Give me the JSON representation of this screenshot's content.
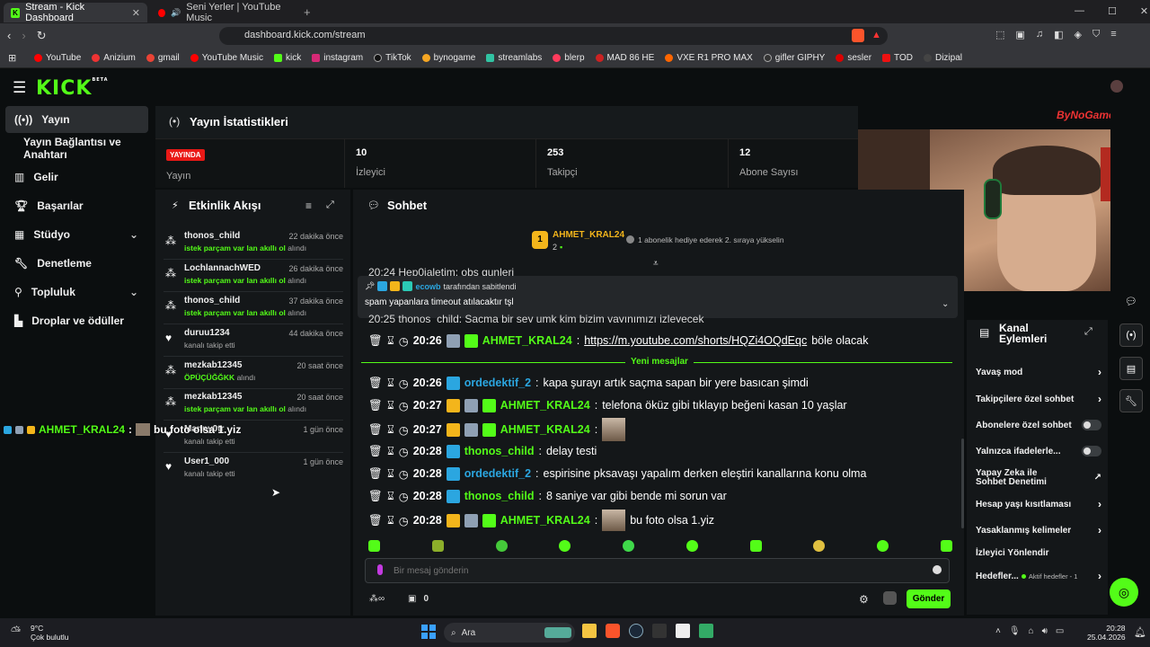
{
  "browser": {
    "tabs": [
      {
        "label": "Stream - Kick Dashboard",
        "active": true
      },
      {
        "label": "Seni Yerler | YouTube Music",
        "active": false
      }
    ],
    "url": "dashboard.kick.com/stream",
    "bookmarks": [
      "YouTube",
      "Anizium",
      "gmail",
      "YouTube Music",
      "kick",
      "instagram",
      "TikTok",
      "bynogame",
      "streamlabs",
      "blerp",
      "MAD 86 HE",
      "VXE R1 PRO MAX",
      "gifler GIPHY",
      "sesler",
      "TOD",
      "Dizipal"
    ]
  },
  "header": {
    "logo": "KICK",
    "beta": "BETA"
  },
  "sidebar": {
    "items": [
      {
        "label": "Yayın",
        "active": true
      },
      {
        "label": "Yayın Bağlantısı ve Anahtarı"
      },
      {
        "label": "Gelir"
      },
      {
        "label": "Başarılar"
      },
      {
        "label": "Stüdyo"
      },
      {
        "label": "Denetleme"
      },
      {
        "label": "Topluluk"
      },
      {
        "label": "Droplar ve ödüller"
      }
    ]
  },
  "stats": {
    "title": "Yayın İstatistikleri",
    "live_badge": "YAYINDA",
    "live_label": "Yayın",
    "viewers": {
      "value": "10",
      "label": "İzleyici"
    },
    "followers": {
      "value": "253",
      "label": "Takipçi"
    },
    "subs": {
      "value": "12",
      "label": "Abone Sayısı"
    }
  },
  "activity": {
    "title": "Etkinlik Akışı",
    "items": [
      {
        "user": "thonos_child",
        "time": "22 dakika önce",
        "highlight": "istek parçam var lan akıllı ol",
        "suffix": "alındı",
        "icon": "reward"
      },
      {
        "user": "LochlannachWED",
        "time": "26 dakika önce",
        "highlight": "istek parçam var lan akıllı ol",
        "suffix": "alındı",
        "icon": "reward"
      },
      {
        "user": "thonos_child",
        "time": "37 dakika önce",
        "highlight": "istek parçam var lan akıllı ol",
        "suffix": "alındı",
        "icon": "reward"
      },
      {
        "user": "duruu1234",
        "time": "44 dakika önce",
        "highlight": "",
        "suffix": "kanalı takip etti",
        "icon": "heart"
      },
      {
        "user": "mezkab12345",
        "time": "20 saat önce",
        "highlight": "ÖPÜÇÜĞĞKK",
        "suffix": "alındı",
        "icon": "reward"
      },
      {
        "user": "mezkab12345",
        "time": "20 saat önce",
        "highlight": "istek parçam var lan akıllı ol",
        "suffix": "alındı",
        "icon": "reward"
      },
      {
        "user": "Manny0tr",
        "time": "1 gün önce",
        "highlight": "",
        "suffix": "kanalı takip etti",
        "icon": "heart"
      },
      {
        "user": "User1_000",
        "time": "1 gün önce",
        "highlight": "",
        "suffix": "kanalı takip etti",
        "icon": "heart"
      }
    ]
  },
  "chat": {
    "title": "Sohbet",
    "top_gifter": {
      "rank": "1",
      "user": "AHMET_KRAL24",
      "count": "2",
      "note": "1 abonelik hediye ederek 2. sıraya yükselin"
    },
    "pinned": {
      "by_user": "ecowb",
      "by_text": "tarafından sabitlendi",
      "text": "spam yapanlara timeout atılacaktır tşl"
    },
    "partial_top": "20:24  Hep0jaletim: obs gunleri",
    "partial_second": "20:25  thonos_child: Saçma bir şey umk kim bizim yayınımızı izleyecek",
    "divider": "Yeni mesajlar",
    "messages": [
      {
        "time": "20:26",
        "user": "AHMET_KRAL24",
        "color": "#53fc18",
        "link": "https://m.youtube.com/shorts/HQZi4OQdEqc",
        "text": "böle olacak",
        "badges": [
          "gray",
          "green"
        ]
      },
      {
        "time": "20:26",
        "user": "ordedektif_2",
        "color": "#2ba6e0",
        "text": "kapa şurayı artık saçma sapan bir yere basıcan şimdi",
        "badges": [
          "blue"
        ]
      },
      {
        "time": "20:27",
        "user": "AHMET_KRAL24",
        "color": "#53fc18",
        "text": "telefona öküz gibi tıklayıp beğeni kasan 10 yaşlar",
        "badges": [
          "gold",
          "gray",
          "green"
        ]
      },
      {
        "time": "20:27",
        "user": "AHMET_KRAL24",
        "color": "#53fc18",
        "text": "",
        "emote": true,
        "badges": [
          "gold",
          "gray",
          "green"
        ]
      },
      {
        "time": "20:28",
        "user": "thonos_child",
        "color": "#53fc18",
        "text": "delay testi",
        "badges": [
          "blue"
        ]
      },
      {
        "time": "20:28",
        "user": "ordedektif_2",
        "color": "#2ba6e0",
        "text": "espirisine pksavaşı yapalım derken eleştiri kanallarına konu olma",
        "badges": [
          "blue"
        ]
      },
      {
        "time": "20:28",
        "user": "thonos_child",
        "color": "#53fc18",
        "text": "8 saniye var gibi bende mi sorun var",
        "badges": [
          "blue"
        ]
      },
      {
        "time": "20:28",
        "user": "AHMET_KRAL24",
        "color": "#53fc18",
        "text": "bu foto olsa 1.yiz",
        "emote": true,
        "badges": [
          "gold",
          "gray",
          "green"
        ]
      }
    ],
    "input_placeholder": "Bir mesaj gönderin",
    "points": "0",
    "send_label": "Gönder"
  },
  "overlay": {
    "user": "AHMET_KRAL24",
    "text": "bu foto olsa 1.yiz"
  },
  "webcam_watermark": "ByNoGame",
  "actions": {
    "title": "Kanal Eylemleri",
    "items": [
      {
        "label": "Yavaş mod",
        "control": "arrow"
      },
      {
        "label": "Takipçilere özel sohbet",
        "control": "arrow"
      },
      {
        "label": "Abonelere özel sohbet",
        "control": "toggle"
      },
      {
        "label": "Yalnızca ifadelerle...",
        "control": "toggle"
      },
      {
        "label": "Yapay Zeka ile Sohbet Denetimi",
        "control": "external"
      },
      {
        "label": "Hesap yaşı kısıtlaması",
        "control": "arrow"
      },
      {
        "label": "Yasaklanmış kelimeler",
        "control": "arrow"
      },
      {
        "label": "İzleyici Yönlendir",
        "control": "none"
      },
      {
        "label": "Hedefler...",
        "control": "arrow",
        "sub": "Aktif hedefler - 1"
      }
    ]
  },
  "taskbar": {
    "weather_temp": "9°C",
    "weather_desc": "Çok bulutlu",
    "search": "Ara",
    "time": "20:28",
    "date": "25.04.2026"
  }
}
